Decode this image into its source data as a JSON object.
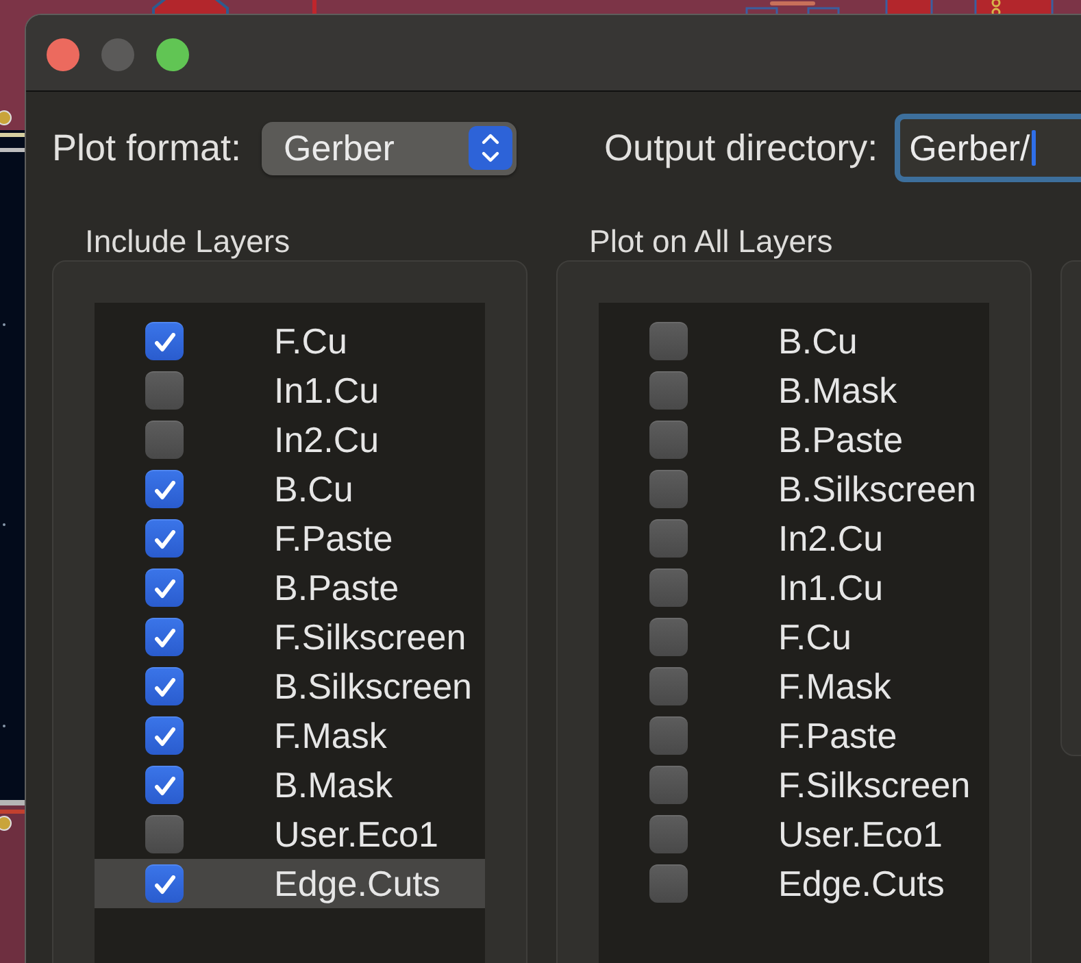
{
  "window": {
    "controls": [
      {
        "kind": "close",
        "disabled": false
      },
      {
        "kind": "minimize",
        "disabled": true
      },
      {
        "kind": "zoom",
        "disabled": false
      }
    ]
  },
  "plot_format": {
    "label": "Plot format:",
    "value": "Gerber"
  },
  "output_directory": {
    "label": "Output directory:",
    "value": "Gerber/",
    "focused": true
  },
  "layer_groups": [
    {
      "title": "Include Layers",
      "items": [
        {
          "label": "F.Cu",
          "checked": true,
          "selected": false
        },
        {
          "label": "In1.Cu",
          "checked": false,
          "selected": false
        },
        {
          "label": "In2.Cu",
          "checked": false,
          "selected": false
        },
        {
          "label": "B.Cu",
          "checked": true,
          "selected": false
        },
        {
          "label": "F.Paste",
          "checked": true,
          "selected": false
        },
        {
          "label": "B.Paste",
          "checked": true,
          "selected": false
        },
        {
          "label": "F.Silkscreen",
          "checked": true,
          "selected": false
        },
        {
          "label": "B.Silkscreen",
          "checked": true,
          "selected": false
        },
        {
          "label": "F.Mask",
          "checked": true,
          "selected": false
        },
        {
          "label": "B.Mask",
          "checked": true,
          "selected": false
        },
        {
          "label": "User.Eco1",
          "checked": false,
          "selected": false
        },
        {
          "label": "Edge.Cuts",
          "checked": true,
          "selected": true
        }
      ]
    },
    {
      "title": "Plot on All Layers",
      "items": [
        {
          "label": "B.Cu",
          "checked": false,
          "selected": false
        },
        {
          "label": "B.Mask",
          "checked": false,
          "selected": false
        },
        {
          "label": "B.Paste",
          "checked": false,
          "selected": false
        },
        {
          "label": "B.Silkscreen",
          "checked": false,
          "selected": false
        },
        {
          "label": "In2.Cu",
          "checked": false,
          "selected": false
        },
        {
          "label": "In1.Cu",
          "checked": false,
          "selected": false
        },
        {
          "label": "F.Cu",
          "checked": false,
          "selected": false
        },
        {
          "label": "F.Mask",
          "checked": false,
          "selected": false
        },
        {
          "label": "F.Paste",
          "checked": false,
          "selected": false
        },
        {
          "label": "F.Silkscreen",
          "checked": false,
          "selected": false
        },
        {
          "label": "User.Eco1",
          "checked": false,
          "selected": false
        },
        {
          "label": "Edge.Cuts",
          "checked": false,
          "selected": false
        }
      ]
    }
  ]
}
